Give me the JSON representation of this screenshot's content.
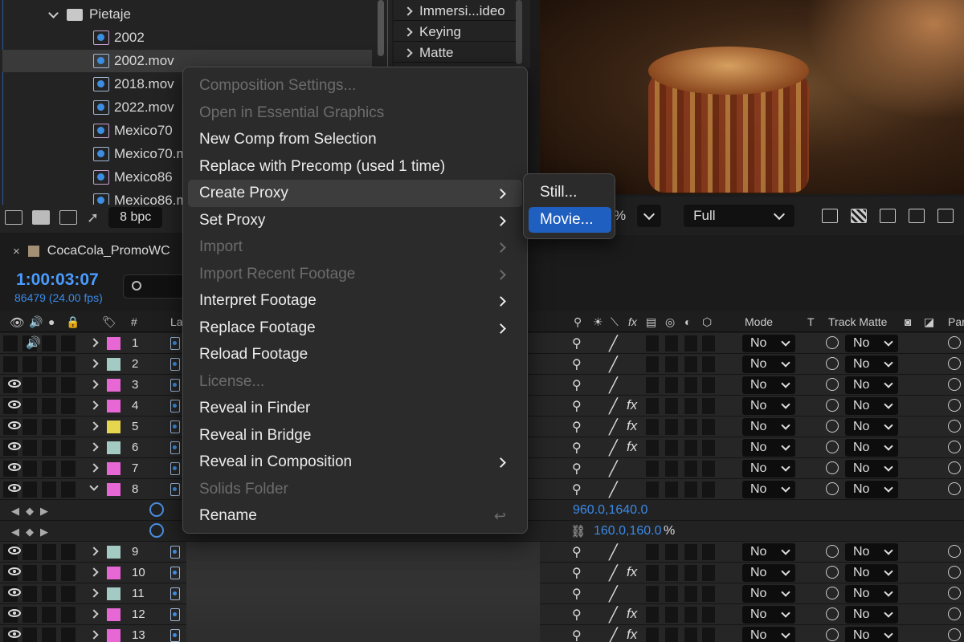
{
  "project_panel": {
    "folder": "Pietaje",
    "items": [
      {
        "name": "2002",
        "type": "comp"
      },
      {
        "name": "2002.mov",
        "type": "footage",
        "selected": true
      },
      {
        "name": "2018.mov",
        "type": "footage"
      },
      {
        "name": "2022.mov",
        "type": "footage"
      },
      {
        "name": "Mexico70",
        "type": "comp"
      },
      {
        "name": "Mexico70.m",
        "type": "footage"
      },
      {
        "name": "Mexico86",
        "type": "comp"
      },
      {
        "name": "Mexico86.m",
        "type": "footage"
      }
    ],
    "bpc": "8 bpc"
  },
  "effects_panel": {
    "items": [
      "Immersi...ideo",
      "Keying",
      "Matte"
    ]
  },
  "viewer": {
    "zoom_suffix": "%",
    "resolution": "Full"
  },
  "timeline": {
    "tab_name": "CocaCola_PromoWC",
    "timecode": "1:00:03:07",
    "frames": "86479 (24.00 fps)",
    "headers": {
      "num": "#",
      "layer": "La",
      "mode": "Mode",
      "t": "T",
      "track_matte": "Track Matte",
      "parent": "Par"
    },
    "layers": [
      {
        "num": "1",
        "color": "#e767d4",
        "eye": false,
        "audio": true,
        "fx": false
      },
      {
        "num": "2",
        "color": "#a4cac4",
        "eye": false,
        "audio": false,
        "fx": false
      },
      {
        "num": "3",
        "color": "#e767d4",
        "eye": true,
        "audio": false,
        "fx": false
      },
      {
        "num": "4",
        "color": "#e767d4",
        "eye": true,
        "audio": false,
        "fx": true
      },
      {
        "num": "5",
        "color": "#e6d54e",
        "eye": true,
        "audio": false,
        "fx": true
      },
      {
        "num": "6",
        "color": "#a4cac4",
        "eye": true,
        "audio": false,
        "fx": true
      },
      {
        "num": "7",
        "color": "#e767d4",
        "eye": true,
        "audio": false,
        "fx": false
      },
      {
        "num": "8",
        "color": "#e767d4",
        "eye": true,
        "audio": false,
        "fx": false,
        "expanded": true
      }
    ],
    "props": [
      {
        "value": "960.0,1640.0",
        "suffix": ""
      },
      {
        "value": "160.0,160.0",
        "suffix": "%"
      }
    ],
    "layers_after": [
      {
        "num": "9",
        "color": "#a4cac4",
        "fx": false
      },
      {
        "num": "10",
        "color": "#e767d4",
        "fx": true
      },
      {
        "num": "11",
        "color": "#a4cac4",
        "fx": false
      },
      {
        "num": "12",
        "color": "#e767d4",
        "fx": true
      },
      {
        "num": "13",
        "color": "#e767d4",
        "fx": true
      }
    ],
    "mode_value": "No",
    "track_matte_value": "No"
  },
  "context_menu": {
    "items": [
      {
        "label": "Composition Settings...",
        "disabled": true
      },
      {
        "label": "Open in Essential Graphics",
        "disabled": true
      },
      {
        "label": "New Comp from Selection",
        "disabled": false
      },
      {
        "label": "Replace with Precomp (used 1 time)",
        "disabled": false
      },
      {
        "label": "Create Proxy",
        "disabled": false,
        "submenu": true,
        "hover": true
      },
      {
        "label": "Set Proxy",
        "disabled": false,
        "submenu": true
      },
      {
        "label": "Import",
        "disabled": true,
        "submenu": true
      },
      {
        "label": "Import Recent Footage",
        "disabled": true,
        "submenu": true
      },
      {
        "label": "Interpret Footage",
        "disabled": false,
        "submenu": true
      },
      {
        "label": "Replace Footage",
        "disabled": false,
        "submenu": true
      },
      {
        "label": "Reload Footage",
        "disabled": false
      },
      {
        "label": "License...",
        "disabled": true
      },
      {
        "label": "Reveal in Finder",
        "disabled": false
      },
      {
        "label": "Reveal in Bridge",
        "disabled": false
      },
      {
        "label": "Reveal in Composition",
        "disabled": false,
        "submenu": true
      },
      {
        "label": "Solids Folder",
        "disabled": true
      },
      {
        "label": "Rename",
        "disabled": false,
        "shortcut": "↩"
      }
    ]
  },
  "submenu": {
    "items": [
      {
        "label": "Still...",
        "active": false
      },
      {
        "label": "Movie...",
        "active": true
      }
    ]
  }
}
